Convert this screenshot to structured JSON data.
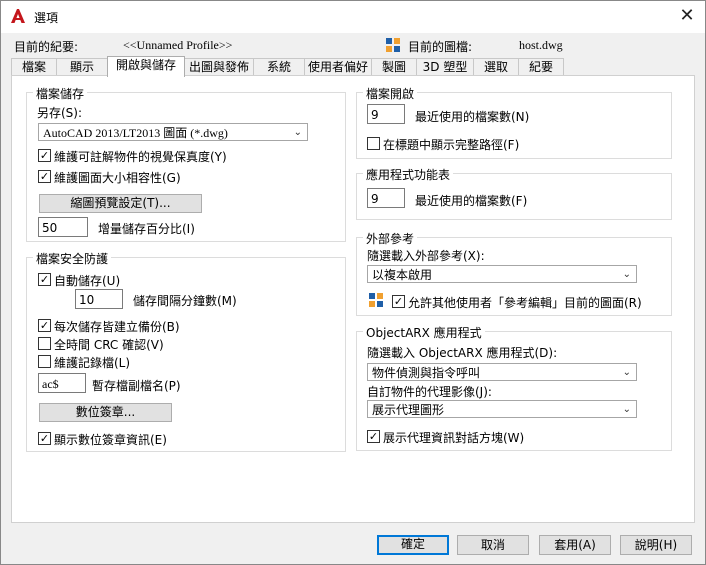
{
  "window": {
    "title": "選項",
    "close": "✕"
  },
  "profile": {
    "current_profile_label": "目前的紀要:",
    "current_profile_value": "<<Unnamed Profile>>",
    "current_drawing_label": "目前的圖檔:",
    "current_drawing_value": "host.dwg"
  },
  "tabs": [
    "檔案",
    "顯示",
    "開啟與儲存",
    "出圖與發佈",
    "系統",
    "使用者偏好",
    "製圖",
    "3D 塑型",
    "選取",
    "紀要"
  ],
  "active_tab": 2,
  "file_save": {
    "title": "檔案儲存",
    "save_as_label": "另存(S):",
    "save_as_value": "AutoCAD 2013/LT2013 圖面 (*.dwg)",
    "maintain_visual": "維護可註解物件的視覺保真度(Y)",
    "maintain_compat": "維護圖面大小相容性(G)",
    "thumbnail_button": "縮圖預覽設定(T)...",
    "incremental_value": "50",
    "incremental_label": "增量儲存百分比(I)"
  },
  "safety": {
    "title": "檔案安全防護",
    "autosave": "自動儲存(U)",
    "interval_value": "10",
    "interval_label": "儲存間隔分鐘數(M)",
    "backup": "每次儲存皆建立備份(B)",
    "crc": "全時間 CRC 確認(V)",
    "log": "維護記錄檔(L)",
    "temp_ext_value": "ac$",
    "temp_ext_label": "暫存檔副檔名(P)",
    "digsig_button": "數位簽章...",
    "show_digsig": "顯示數位簽章資訊(E)"
  },
  "file_open": {
    "title": "檔案開啟",
    "recent_value": "9",
    "recent_label": "最近使用的檔案數(N)",
    "full_path": "在標題中顯示完整路徑(F)"
  },
  "app_menu": {
    "title": "應用程式功能表",
    "recent_value": "9",
    "recent_label": "最近使用的檔案數(F)"
  },
  "xref": {
    "title": "外部參考",
    "demand_label": "隨選載入外部參考(X):",
    "demand_value": "以複本啟用",
    "allow_edit": "允許其他使用者「參考編輯」目前的圖面(R)"
  },
  "arx": {
    "title": "ObjectARX 應用程式",
    "demand_label": "隨選載入 ObjectARX 應用程式(D):",
    "demand_value": "物件偵測與指令呼叫",
    "proxy_label": "自訂物件的代理影像(J):",
    "proxy_value": "展示代理圖形",
    "show_proxy": "展示代理資訊對話方塊(W)"
  },
  "buttons": {
    "ok": "確定",
    "cancel": "取消",
    "apply": "套用(A)",
    "help": "說明(H)"
  },
  "colors": {
    "accent": "#0078d7",
    "brand_red": "#c4161c"
  }
}
